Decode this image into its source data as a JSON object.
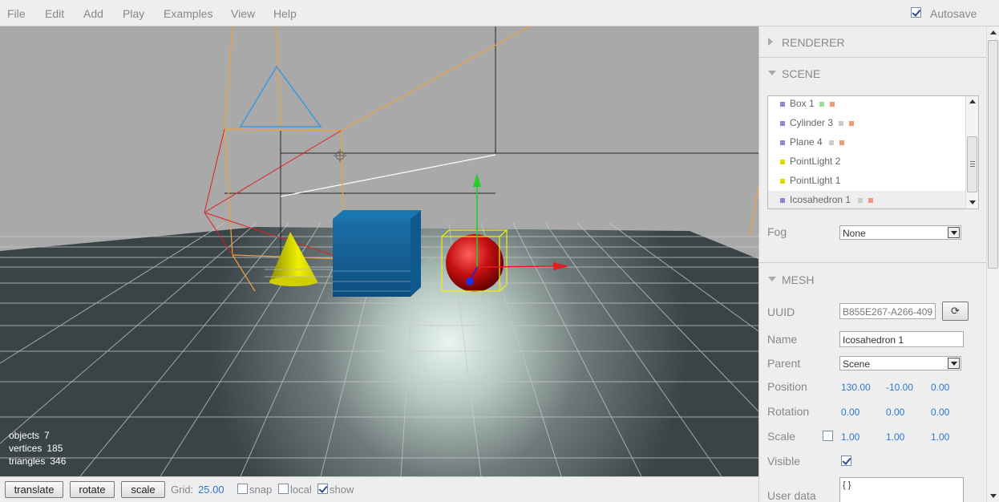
{
  "menubar": {
    "items": [
      "File",
      "Edit",
      "Add",
      "Play",
      "Examples",
      "View",
      "Help"
    ],
    "autosave_label": "Autosave",
    "autosave_checked": true
  },
  "viewport": {
    "info": {
      "objects_label": "objects",
      "objects_value": "7",
      "vertices_label": "vertices",
      "vertices_value": "185",
      "triangles_label": "triangles",
      "triangles_value": "346"
    }
  },
  "toolbar": {
    "translate_label": "translate",
    "rotate_label": "rotate",
    "scale_label": "scale",
    "grid_label": "Grid:",
    "grid_value": "25.00",
    "snap_label": "snap",
    "snap_checked": false,
    "local_label": "local",
    "local_checked": false,
    "show_label": "show",
    "show_checked": true
  },
  "sidebar": {
    "renderer_title": "RENDERER",
    "scene_title": "SCENE",
    "outliner": [
      {
        "name": "Box 1",
        "color": "#8888dd",
        "geometry_color": "#99dd99",
        "material_color": "#ee9977",
        "selected": false
      },
      {
        "name": "Cylinder 3",
        "color": "#8888dd",
        "geometry_color": "#cccccc",
        "material_color": "#ee9977",
        "selected": false
      },
      {
        "name": "Plane 4",
        "color": "#8888dd",
        "geometry_color": "#cccccc",
        "material_color": "#ee9977",
        "selected": false
      },
      {
        "name": "PointLight 2",
        "color": "#dddd00",
        "selected": false
      },
      {
        "name": "PointLight 1",
        "color": "#dddd00",
        "selected": false
      },
      {
        "name": "Icosahedron 1",
        "color": "#8888dd",
        "geometry_color": "#cccccc",
        "material_color": "#ee9977",
        "selected": true
      }
    ],
    "fog_label": "Fog",
    "fog_value": "None",
    "mesh_title": "MESH",
    "uuid_label": "UUID",
    "uuid_value": "B855E267-A266-409",
    "uuid_button": "⟳",
    "name_label": "Name",
    "name_value": "Icosahedron 1",
    "parent_label": "Parent",
    "parent_value": "Scene",
    "position_label": "Position",
    "position": [
      "130.00",
      "-10.00",
      "0.00"
    ],
    "rotation_label": "Rotation",
    "rotation": [
      "0.00",
      "0.00",
      "0.00"
    ],
    "scale_label": "Scale",
    "scale_lock_checked": false,
    "scale": [
      "1.00",
      "1.00",
      "1.00"
    ],
    "visible_label": "Visible",
    "visible_checked": true,
    "userdata_label": "User data",
    "userdata_value": "{ }"
  }
}
